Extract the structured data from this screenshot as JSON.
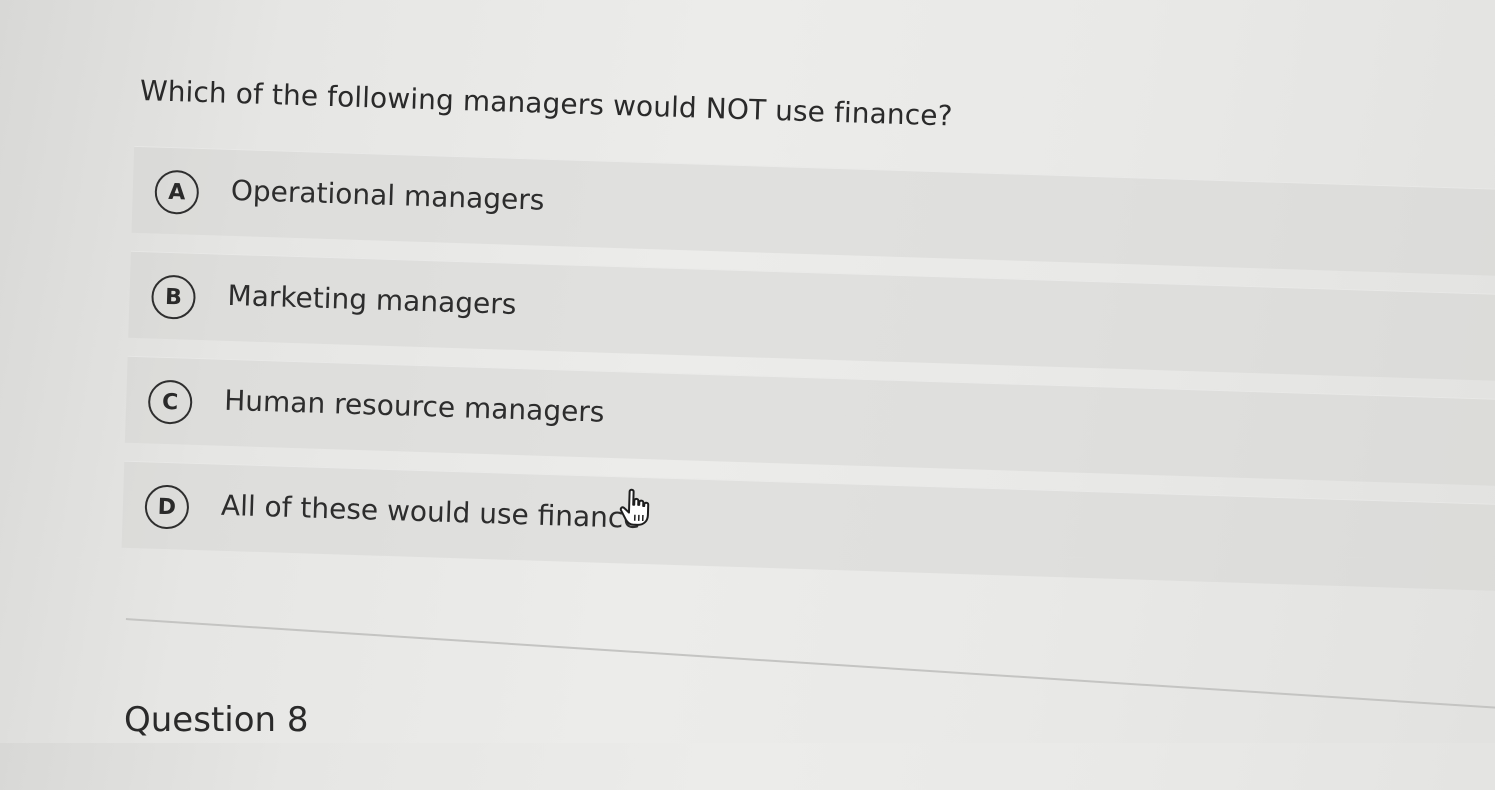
{
  "question": {
    "text": "Which of the following managers would NOT use finance?"
  },
  "options": [
    {
      "letter": "A",
      "label": "Operational managers"
    },
    {
      "letter": "B",
      "label": "Marketing managers"
    },
    {
      "letter": "C",
      "label": "Human resource managers"
    },
    {
      "letter": "D",
      "label": "All of these would use finance"
    }
  ],
  "cursor": {
    "icon": "hand-pointer-icon"
  },
  "next_section": {
    "label": "Question 8"
  },
  "colors": {
    "text": "#2a2a2a",
    "option_background": "#d9d9d7",
    "page_background": "#e8e8e6"
  }
}
